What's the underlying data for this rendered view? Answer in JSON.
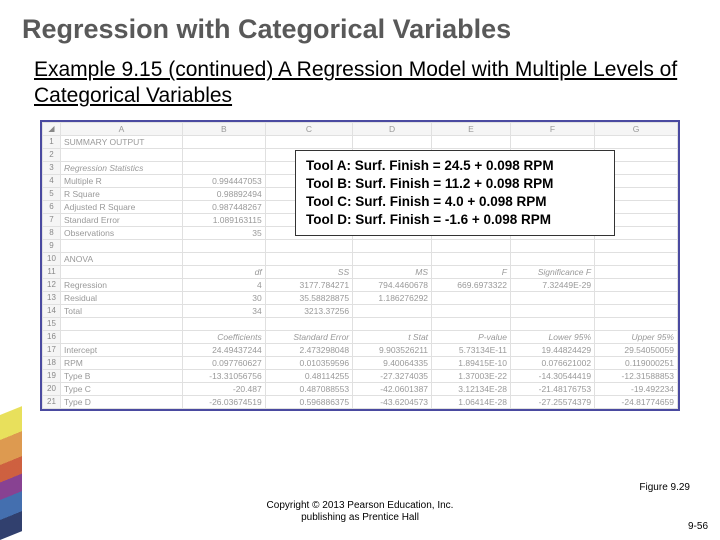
{
  "title": "Regression with Categorical Variables",
  "subtitle": "Example 9.15 (continued)  A Regression Model with Multiple Levels of Categorical Variables",
  "equations": {
    "a": "Tool A: Surf. Finish = 24.5 + 0.098 RPM",
    "b": "Tool B: Surf. Finish = 11.2 + 0.098 RPM",
    "c": "Tool C: Surf. Finish =   4.0 + 0.098 RPM",
    "d": "Tool D: Surf. Finish =  -1.6 + 0.098 RPM"
  },
  "excel": {
    "cornerIcon": "◢",
    "cols": [
      "A",
      "B",
      "C",
      "D",
      "E",
      "F",
      "G"
    ],
    "rows": [
      {
        "n": "1",
        "cells": [
          "SUMMARY OUTPUT",
          "",
          "",
          "",
          "",
          "",
          ""
        ]
      },
      {
        "n": "2",
        "cells": [
          "",
          "",
          "",
          "",
          "",
          "",
          ""
        ]
      },
      {
        "n": "3",
        "cells": [
          "Regression Statistics",
          "",
          "",
          "",
          "",
          "",
          ""
        ],
        "italic": true
      },
      {
        "n": "4",
        "cells": [
          "Multiple R",
          "0.994447053",
          "",
          "",
          "",
          "",
          ""
        ]
      },
      {
        "n": "5",
        "cells": [
          "R Square",
          "0.98892494",
          "",
          "",
          "",
          "",
          ""
        ]
      },
      {
        "n": "6",
        "cells": [
          "Adjusted R Square",
          "0.987448267",
          "",
          "",
          "",
          "",
          ""
        ]
      },
      {
        "n": "7",
        "cells": [
          "Standard Error",
          "1.089163115",
          "",
          "",
          "",
          "",
          ""
        ]
      },
      {
        "n": "8",
        "cells": [
          "Observations",
          "35",
          "",
          "",
          "",
          "",
          ""
        ]
      },
      {
        "n": "9",
        "cells": [
          "",
          "",
          "",
          "",
          "",
          "",
          ""
        ]
      },
      {
        "n": "10",
        "cells": [
          "ANOVA",
          "",
          "",
          "",
          "",
          "",
          ""
        ]
      },
      {
        "n": "11",
        "cells": [
          "",
          "df",
          "SS",
          "MS",
          "F",
          "Significance F",
          ""
        ],
        "italic": true
      },
      {
        "n": "12",
        "cells": [
          "Regression",
          "4",
          "3177.784271",
          "794.4460678",
          "669.6973322",
          "7.32449E-29",
          ""
        ]
      },
      {
        "n": "13",
        "cells": [
          "Residual",
          "30",
          "35.58828875",
          "1.186276292",
          "",
          "",
          ""
        ]
      },
      {
        "n": "14",
        "cells": [
          "Total",
          "34",
          "3213.37256",
          "",
          "",
          "",
          ""
        ]
      },
      {
        "n": "15",
        "cells": [
          "",
          "",
          "",
          "",
          "",
          "",
          ""
        ]
      },
      {
        "n": "16",
        "cells": [
          "",
          "Coefficients",
          "Standard Error",
          "t Stat",
          "P-value",
          "Lower 95%",
          "Upper 95%"
        ],
        "italic": true
      },
      {
        "n": "17",
        "cells": [
          "Intercept",
          "24.49437244",
          "2.473298048",
          "9.903526211",
          "5.73134E-11",
          "19.44824429",
          "29.54050059"
        ]
      },
      {
        "n": "18",
        "cells": [
          "RPM",
          "0.097760627",
          "0.010359596",
          "9.40064335",
          "1.89415E-10",
          "0.076621002",
          "0.119000251"
        ]
      },
      {
        "n": "19",
        "cells": [
          "Type B",
          "-13.31056756",
          "0.48114255",
          "-27.3274035",
          "1.37003E-22",
          "-14.30544419",
          "-12.31588853"
        ]
      },
      {
        "n": "20",
        "cells": [
          "Type C",
          "-20.487",
          "0.487088553",
          "-42.0601387",
          "3.12134E-28",
          "-21.48176753",
          "-19.492234"
        ]
      },
      {
        "n": "21",
        "cells": [
          "Type D",
          "-26.03674519",
          "0.596886375",
          "-43.6204573",
          "1.06414E-28",
          "-27.25574379",
          "-24.81774659"
        ]
      }
    ]
  },
  "figureLabel": "Figure 9.29",
  "copyright1": "Copyright © 2013 Pearson Education, Inc.",
  "copyright2": "publishing as Prentice Hall",
  "slideNum": "9-56"
}
